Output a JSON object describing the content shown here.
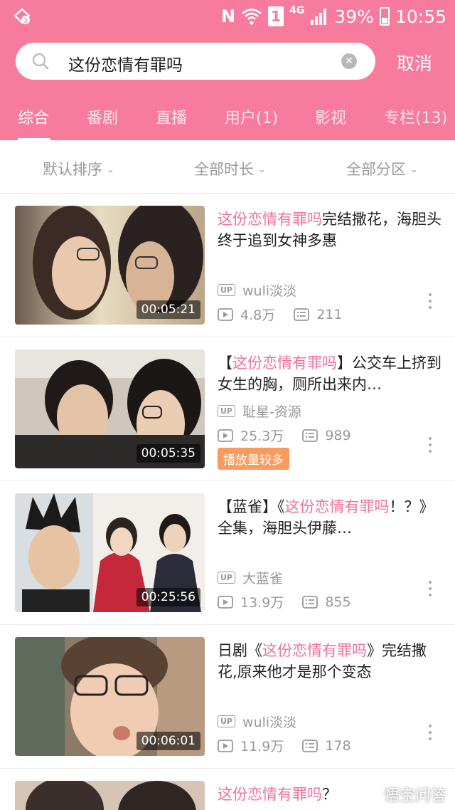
{
  "status_bar": {
    "network_letter": "N",
    "sim_slot": "1",
    "network_type": "4G",
    "battery": "39%",
    "time": "10:55"
  },
  "search": {
    "query": "这份恋情有罪吗",
    "cancel_label": "取消"
  },
  "tabs": [
    {
      "label": "综合",
      "active": true
    },
    {
      "label": "番剧"
    },
    {
      "label": "直播"
    },
    {
      "label": "用户(1)"
    },
    {
      "label": "影视"
    },
    {
      "label": "专栏(13)"
    }
  ],
  "filters": [
    {
      "label": "默认排序"
    },
    {
      "label": "全部时长"
    },
    {
      "label": "全部分区"
    }
  ],
  "results": [
    {
      "title_prefix": "",
      "title_highlight": "这份恋情有罪吗",
      "title_suffix": "完结撒花，海胆头终于追到女神多惠",
      "duration": "00:05:21",
      "uploader": "wuli淡淡",
      "views": "4.8万",
      "comments": "211",
      "tag": ""
    },
    {
      "title_prefix": "【",
      "title_highlight": "这份恋情有罪吗",
      "title_suffix": "】公交车上挤到女生的胸，厕所出来内…",
      "duration": "00:05:35",
      "uploader": "耻星-资源",
      "views": "25.3万",
      "comments": "989",
      "tag": "播放量较多"
    },
    {
      "title_prefix": "【蓝雀】《",
      "title_highlight": "这份恋情有罪吗",
      "title_suffix": "！？》全集，海胆头伊藤…",
      "duration": "00:25:56",
      "uploader": "大蓝雀",
      "views": "13.9万",
      "comments": "855",
      "tag": ""
    },
    {
      "title_prefix": "日剧《",
      "title_highlight": "这份恋情有罪吗",
      "title_suffix": "》完结撒花,原来他才是那个变态",
      "duration": "00:06:01",
      "uploader": "wuli淡淡",
      "views": "11.9万",
      "comments": "178",
      "tag": ""
    },
    {
      "title_prefix": "",
      "title_highlight": "这份恋情有罪吗",
      "title_suffix": "？",
      "duration": "",
      "uploader": "",
      "views": "",
      "comments": "",
      "tag": ""
    }
  ],
  "watermark": "悟空问答",
  "icons": {
    "status_left": "data-saver-icon",
    "search": "search-icon",
    "clear": "clear-icon",
    "play": "play-count-icon",
    "comment": "danmaku-icon",
    "more": "more-vertical-icon"
  },
  "colors": {
    "brand_pink": "#f77b9c",
    "highlight_pink": "#f0729a",
    "hot_tag_orange": "#fb9a5d"
  }
}
